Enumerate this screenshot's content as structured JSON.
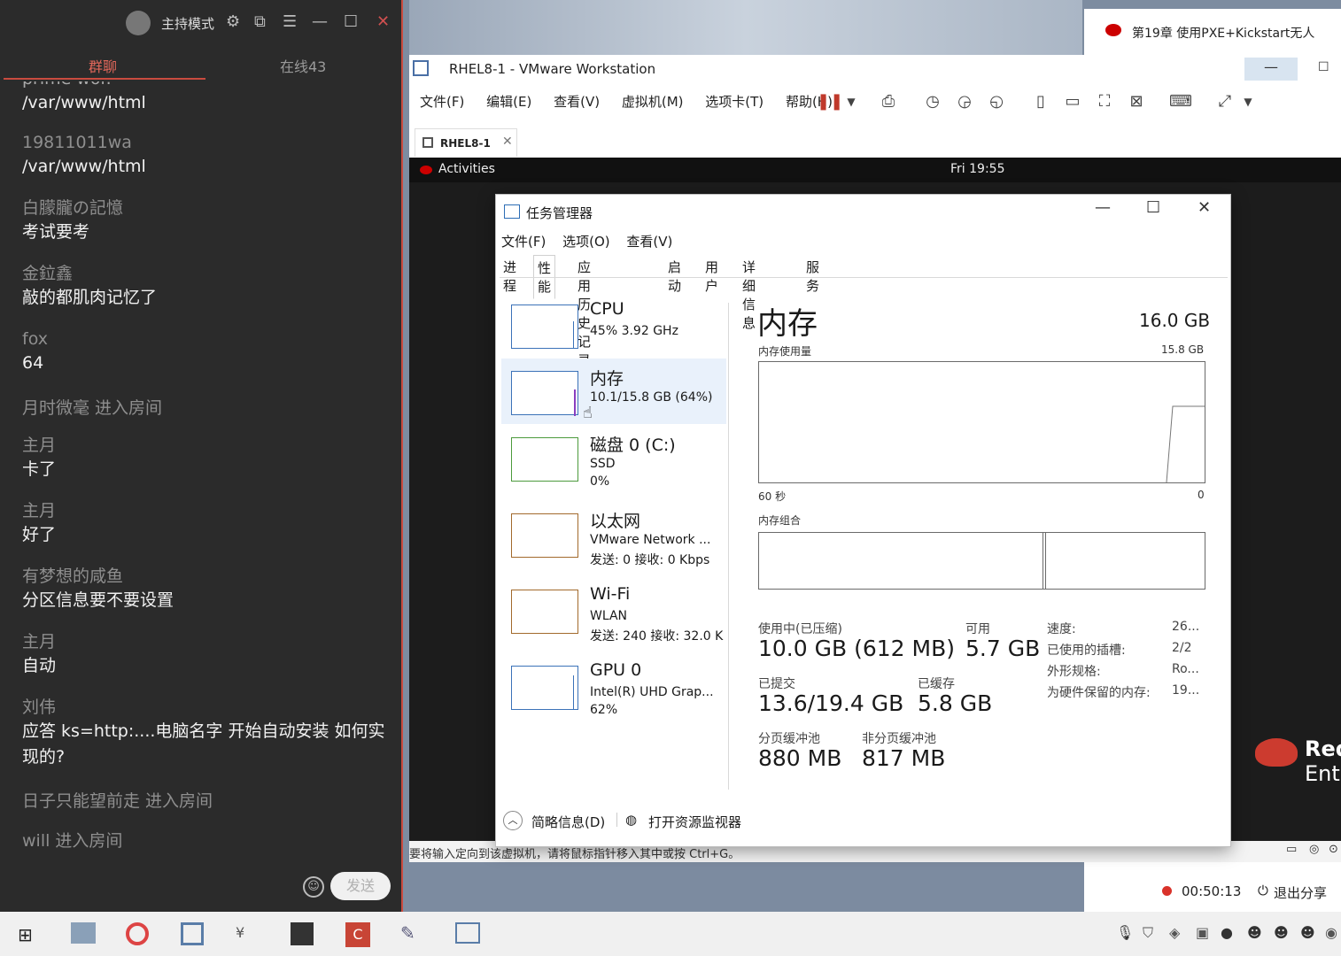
{
  "chat": {
    "host_mode": "主持模式",
    "tab_group": "群聊",
    "tab_online": "在线43",
    "clipped_top": "prime wor.",
    "messages": [
      {
        "nick": "",
        "text": "/var/www/html"
      },
      {
        "nick": "19811011wa",
        "text": "/var/www/html"
      },
      {
        "nick": "白朦朧の記憶",
        "text": "考试要考"
      },
      {
        "nick": "金鉝鑫",
        "text": "敲的都肌肉记忆了"
      },
      {
        "nick": "fox",
        "text": "64"
      },
      {
        "nick": "主月",
        "text": "卡了"
      },
      {
        "nick": "主月",
        "text": "好了"
      },
      {
        "nick": "有梦想的咸鱼",
        "text": "分区信息要不要设置"
      },
      {
        "nick": "主月",
        "text": "自动"
      },
      {
        "nick": "刘伟",
        "text": "应答 ks=http:....电脑名字 开始自动安装 如何实现的?"
      }
    ],
    "system": [
      "月时微毫 进入房间",
      "日子只能望前走 进入房间",
      "will 进入房间"
    ],
    "send_label": "发送"
  },
  "browser": {
    "tab_title": "第19章 使用PXE+Kickstart无人"
  },
  "vmware": {
    "title": "RHEL8-1 - VMware Workstation",
    "menu": [
      "文件(F)",
      "编辑(E)",
      "查看(V)",
      "虚拟机(M)",
      "选项卡(T)",
      "帮助(H)"
    ],
    "vm_tab": "RHEL8-1",
    "status_text": "要将输入定向到该虚拟机，请将鼠标指针移入其中或按 Ctrl+G。"
  },
  "gnome": {
    "activities": "Activities",
    "clock": "Fri 19:55"
  },
  "redhat": {
    "line1": "Red",
    "line2": "Ent"
  },
  "share": {
    "timer": "00:50:13",
    "exit": "退出分享"
  },
  "taskmgr": {
    "title": "任务管理器",
    "menu": [
      "文件(F)",
      "选项(O)",
      "查看(V)"
    ],
    "tabs": [
      "进程",
      "性能",
      "应用历史记录",
      "启动",
      "用户",
      "详细信息",
      "服务"
    ],
    "resources": [
      {
        "name": "CPU",
        "l2": "45% 3.92 GHz",
        "l3": ""
      },
      {
        "name": "内存",
        "l2": "10.1/15.8 GB (64%)",
        "l3": ""
      },
      {
        "name": "磁盘 0 (C:)",
        "l2": "SSD",
        "l3": "0%"
      },
      {
        "name": "以太网",
        "l2": "VMware Network ...",
        "l3": "发送: 0 接收: 0 Kbps"
      },
      {
        "name": "Wi-Fi",
        "l2": "WLAN",
        "l3": "发送: 240 接收: 32.0 K"
      },
      {
        "name": "GPU 0",
        "l2": "Intel(R) UHD Grap...",
        "l3": "62%"
      }
    ],
    "memory": {
      "title": "内存",
      "total": "16.0 GB",
      "usage_label": "内存使用量",
      "usage_max": "15.8 GB",
      "axis_left": "60 秒",
      "axis_right": "0",
      "composition_label": "内存组合",
      "in_use_label": "使用中(已压缩)",
      "in_use_value": "10.0 GB (612 MB)",
      "available_label": "可用",
      "available_value": "5.7 GB",
      "committed_label": "已提交",
      "committed_value": "13.6/19.4 GB",
      "cached_label": "已缓存",
      "cached_value": "5.8 GB",
      "paged_label": "分页缓冲池",
      "paged_value": "880 MB",
      "nonpaged_label": "非分页缓冲池",
      "nonpaged_value": "817 MB",
      "speed_label": "速度:",
      "speed_value": "26...",
      "slots_label": "已使用的插槽:",
      "slots_value": "2/2",
      "form_label": "外形规格:",
      "form_value": "Ro...",
      "reserved_label": "为硬件保留的内存:",
      "reserved_value": "19..."
    },
    "footer_less": "简略信息(D)",
    "footer_monitor": "打开资源监视器"
  }
}
